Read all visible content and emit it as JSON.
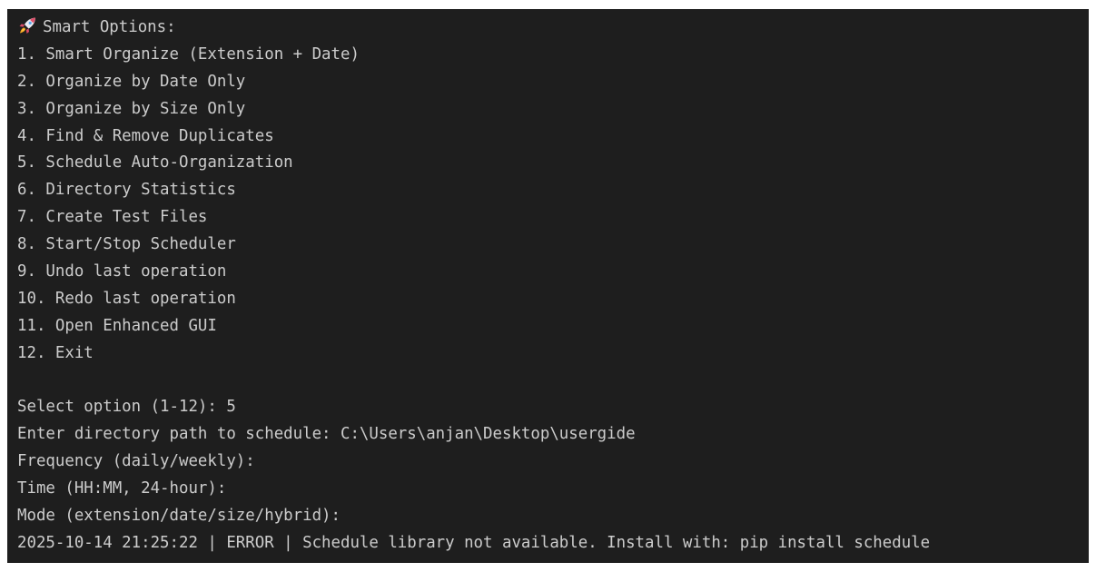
{
  "header": {
    "icon": "rocket-icon",
    "title": "Smart Options:"
  },
  "menu": {
    "items": [
      "1. Smart Organize (Extension + Date)",
      "2. Organize by Date Only",
      "3. Organize by Size Only",
      "4. Find & Remove Duplicates",
      "5. Schedule Auto-Organization",
      "6. Directory Statistics",
      "7. Create Test Files",
      "8. Start/Stop Scheduler",
      "9. Undo last operation",
      "10. Redo last operation",
      "11. Open Enhanced GUI",
      "12. Exit"
    ]
  },
  "session": {
    "select_prompt": "Select option (1-12): 5",
    "directory_prompt": "Enter directory path to schedule: C:\\Users\\anjan\\Desktop\\usergide",
    "frequency_prompt": "Frequency (daily/weekly):",
    "time_prompt": "Time (HH:MM, 24-hour):",
    "mode_prompt": "Mode (extension/date/size/hybrid):",
    "log_line": "2025-10-14 21:25:22 | ERROR | Schedule library not available. Install with: pip install schedule"
  },
  "colors": {
    "terminal_background": "#1e1e1e",
    "text": "#cccccc"
  }
}
